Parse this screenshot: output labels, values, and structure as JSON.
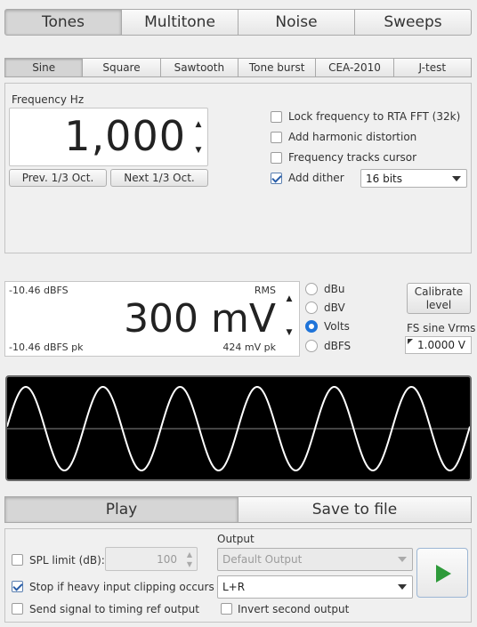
{
  "top_tabs": [
    "Tones",
    "Multitone",
    "Noise",
    "Sweeps"
  ],
  "sub_tabs": [
    "Sine",
    "Square",
    "Sawtooth",
    "Tone burst",
    "CEA-2010",
    "J-test"
  ],
  "frequency": {
    "label": "Frequency Hz",
    "value": "1,000",
    "prev_label": "Prev. 1/3 Oct.",
    "next_label": "Next 1/3 Oct."
  },
  "options": {
    "lock_rta": "Lock frequency to RTA FFT (32k)",
    "harmonic": "Add harmonic distortion",
    "tracks_cursor": "Frequency tracks cursor",
    "dither": "Add dither",
    "dither_bits": "16 bits",
    "lock_rta_checked": false,
    "harmonic_checked": false,
    "tracks_cursor_checked": false,
    "dither_checked": true
  },
  "level": {
    "top_left": "-10.46 dBFS",
    "top_right": "RMS",
    "value": "300 mV",
    "bottom_left": "-10.46 dBFS pk",
    "bottom_right": "424 mV pk",
    "units": [
      "dBu",
      "dBV",
      "Volts",
      "dBFS"
    ],
    "selected_unit": "Volts",
    "calibrate_line1": "Calibrate",
    "calibrate_line2": "level",
    "fs_label": "FS sine Vrms",
    "fs_value": "1.0000 V"
  },
  "waveform": {
    "cycles": 6,
    "color": "#ffffff",
    "background": "#000000"
  },
  "action_tabs": [
    "Play",
    "Save to file"
  ],
  "play": {
    "spl_label": "SPL limit (dB):",
    "spl_value": "100",
    "stop_clip": "Stop if heavy input clipping occurs",
    "timing_ref": "Send signal to timing ref output",
    "output_label": "Output",
    "output_device": "Default Output",
    "channel": "L+R",
    "invert": "Invert second output",
    "spl_checked": false,
    "stop_clip_checked": true,
    "timing_ref_checked": false,
    "invert_checked": false,
    "play_icon_color": "#2e9a3a"
  }
}
